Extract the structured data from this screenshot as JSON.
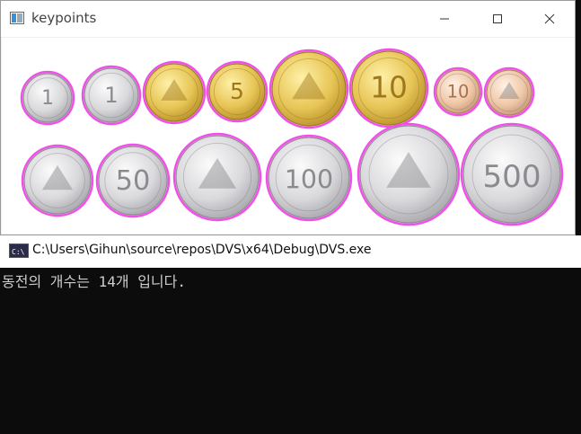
{
  "keypoints_window": {
    "title": "keypoints",
    "icon": "image-window-icon",
    "coins": [
      {
        "label": "1",
        "kind": "aluminum-flower",
        "tone": "silver"
      },
      {
        "label": "1",
        "kind": "one-won",
        "tone": "silver"
      },
      {
        "label": "",
        "kind": "ship",
        "tone": "gold"
      },
      {
        "label": "5",
        "kind": "five-won",
        "tone": "gold"
      },
      {
        "label": "",
        "kind": "pagoda",
        "tone": "gold"
      },
      {
        "label": "10",
        "kind": "ten-won",
        "tone": "gold"
      },
      {
        "label": "10",
        "kind": "ten-won-small",
        "tone": "pink"
      },
      {
        "label": "",
        "kind": "pagoda-small",
        "tone": "pink"
      },
      {
        "label": "",
        "kind": "rice",
        "tone": "silver"
      },
      {
        "label": "50",
        "kind": "fifty-won",
        "tone": "silver"
      },
      {
        "label": "",
        "kind": "portrait",
        "tone": "silver"
      },
      {
        "label": "100",
        "kind": "hundred-won",
        "tone": "silver"
      },
      {
        "label": "",
        "kind": "crane",
        "tone": "silver"
      },
      {
        "label": "500",
        "kind": "five-hundred-won",
        "tone": "silver"
      }
    ],
    "keypoint_color": "#f050e8"
  },
  "console_window": {
    "title": "C:\\Users\\Gihun\\source\\repos\\DVS\\x64\\Debug\\DVS.exe",
    "icon": "console-icon",
    "output": "동전의 개수는 14개 입니다."
  },
  "window_controls": {
    "minimize": "minimize-icon",
    "maximize": "maximize-icon",
    "close": "close-icon"
  }
}
